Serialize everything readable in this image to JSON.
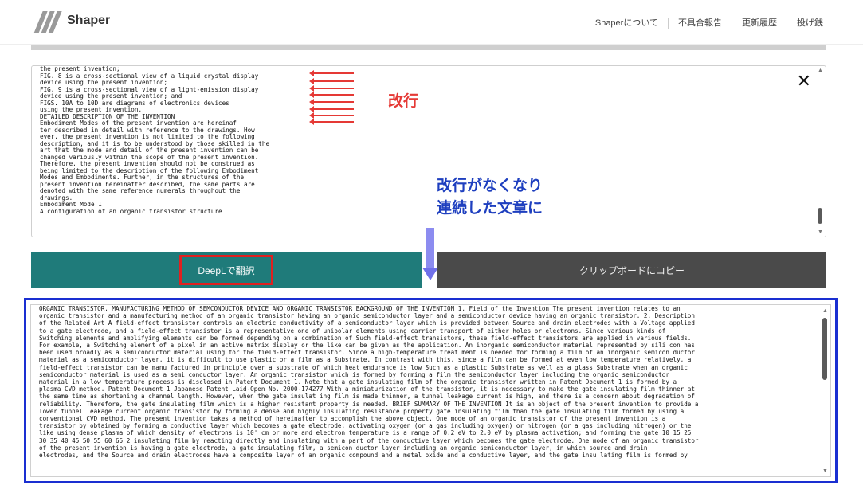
{
  "header": {
    "brand": "Shaper",
    "nav": [
      "Shaperについて",
      "不具合報告",
      "更新履歴",
      "投げ銭"
    ]
  },
  "source": {
    "lines": [
      "the present invention;",
      "FIG. 8 is a cross-sectional view of a liquid crystal display",
      "device using the present invention;",
      "FIG. 9 is a cross-sectional view of a light-emission display",
      "device using the present invention; and",
      "FIGS. 10A to 10D are diagrams of electronics devices",
      "using the present invention.",
      "DETAILED DESCRIPTION OF THE INVENTION",
      "Embodiment Modes of the present invention are hereinaf",
      "ter described in detail with reference to the drawings. How",
      "ever, the present invention is not limited to the following",
      "description, and it is to be understood by those skilled in the",
      "art that the mode and detail of the present invention can be",
      "changed variously within the scope of the present invention.",
      "Therefore, the present invention should not be construed as",
      "being limited to the description of the following Embodiment",
      "Modes and Embodiments. Further, in the structures of the",
      "present invention hereinafter described, the same parts are",
      "denoted with the same reference numerals throughout the",
      "drawings.",
      "Embodiment Mode 1",
      "A configuration of an organic transistor structure"
    ],
    "close_icon": "close-icon"
  },
  "annotations": {
    "newline_label": "改行",
    "result_label_line1": "改行がなくなり",
    "result_label_line2": "連続した文章に"
  },
  "buttons": {
    "translate": "DeepLで翻訳",
    "copy": "クリップボードにコピー"
  },
  "output": {
    "lines": [
      "ORGANIC TRANSISTOR, MANUFACTURING METHOD OF SEMCONDUCTOR DEVICE AND ORGANIC TRANSISTOR BACKGROUND OF THE INVENTION 1. Field of the Invention The present invention relates to an",
      "organic transistor and a manufacturing method of an organic transistor having an organic semiconductor layer and a semiconductor device having an organic transistor. 2. Description",
      "of the Related Art A field-effect transistor controls an electric conductivity of a semiconductor layer which is provided between Source and drain electrodes with a Voltage applied",
      "to a gate electrode, and a field-effect transistor is a representative one of unipolar elements using carrier transport of either holes or electrons. Since various kinds of",
      "Switching elements and amplifying elements can be formed depending on a combination of Such field-effect transistors, these field-effect transistors are applied in various fields.",
      "For example, a Switching element of a pixel in an active matrix display or the like can be given as the application. An inorganic semiconductor material represented by sili con has",
      "been used broadly as a semiconductor material using for the field-effect transistor. Since a high-temperature treat ment is needed for forming a film of an inorganic semicon ductor",
      "material as a semiconductor layer, it is difficult to use plastic or a film as a Substrate. In contrast with this, since a film can be formed at even low temperature relatively, a",
      "field-effect transistor can be manu factured in principle over a substrate of which heat endurance is low Such as a plastic Substrate as well as a glass Substrate when an organic",
      "semiconductor material is used as a semi conductor layer. An organic transistor which is formed by forming a film the semiconductor layer including the organic semiconductor",
      "material in a low temperature process is disclosed in Patent Document 1. Note that a gate insulating film of the organic transistor written in Patent Document 1 is formed by a",
      "plasma CVD method. Patent Document 1 Japanese Patent Laid-Open No. 2000-174277 With a miniaturization of the transistor, it is necessary to make the gate insulating film thinner at",
      "the same time as shortening a channel length. However, when the gate insulat ing film is made thinner, a tunnel leakage current is high, and there is a concern about degradation of",
      "reliability. Therefore, the gate insulating film which is a higher resistant property is needed. BRIEF SUMMARY OF THE INVENTION It is an object of the present invention to provide a",
      "lower tunnel leakage current organic transistor by forming a dense and highly insulating resistance property gate insulating film than the gate insulating film formed by using a",
      "conventional CVD method. The present invention takes a method of hereinafter to accomplish the above object. One mode of an organic transistor of the present invention is a",
      "transistor by obtained by forming a conductive layer which becomes a gate electrode; activating oxygen (or a gas including oxygen) or nitrogen (or a gas including nitrogen) or the",
      "like using dense plasma of which density of electrons is 10' cm or more and electron temperature is a range of 0.2 eV to 2.0 eV by plasma activation; and forming the gate 10 15 25",
      "30 35 40 45 50 55 60 65 2 insulating film by reacting directly and insulating with a part of the conductive layer which becomes the gate electrode. One mode of an organic transistor",
      "of the present invention is having a gate electrode, a gate insulating film, a semicon ductor layer including an organic semiconductor layer, in which source and drain",
      "electrodes, and the Source and drain electrodes have a composite layer of an organic compound and a metal oxide and a conductive layer, and the gate insu lating film is formed by"
    ]
  }
}
